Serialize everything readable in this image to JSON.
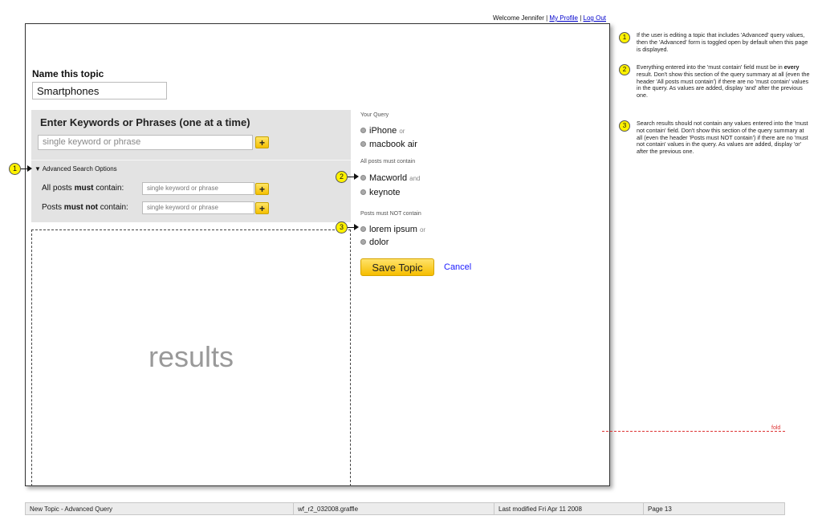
{
  "header": {
    "welcome_text": "Welcome Jennifer",
    "separator": "|",
    "my_profile": "My Profile",
    "log_out": "Log Out"
  },
  "topic": {
    "label": "Name this topic",
    "value": "Smartphones"
  },
  "keywords": {
    "heading": "Enter Keywords or Phrases (one at a time)",
    "placeholder": "single keyword or phrase",
    "add_label": "+"
  },
  "advanced": {
    "toggle_label": "▼ Advanced Search Options",
    "must_prefix": "All posts ",
    "must_bold": "must",
    "must_suffix": " contain:",
    "mustnot_prefix": "Posts ",
    "mustnot_bold": "must not",
    "mustnot_suffix": " contain:",
    "placeholder": "single keyword or phrase",
    "add_label": "+"
  },
  "results": {
    "label": "results"
  },
  "query": {
    "your_query_heading": "Your Query",
    "your_query_items": [
      {
        "text": "iPhone",
        "conj": "or"
      },
      {
        "text": "macbook air",
        "conj": ""
      }
    ],
    "must_heading": "All posts must contain",
    "must_items": [
      {
        "text": "Macworld",
        "conj": "and"
      },
      {
        "text": "keynote",
        "conj": ""
      }
    ],
    "not_heading": "Posts must NOT contain",
    "not_items": [
      {
        "text": "lorem ipsum",
        "conj": "or"
      },
      {
        "text": "dolor",
        "conj": ""
      }
    ]
  },
  "actions": {
    "save": "Save Topic",
    "cancel": "Cancel"
  },
  "callouts": [
    "1",
    "2",
    "3"
  ],
  "notes": [
    {
      "num": "1",
      "text": "If the user is editing a topic that includes 'Advanced' query values, then the 'Advanced' form is toggled open by default when this page is displayed."
    },
    {
      "num": "2",
      "text_before": "Everything entered into the 'must contain' field must be in ",
      "bold": "every",
      "text_after": " result. Don't show this section of the query summary at all (even the header 'All posts must contain') if there are no 'must contain' values in the query. As values are added, display 'and' after the previous one."
    },
    {
      "num": "3",
      "text": "Search results should not contain any values entered into the 'must not contain' field. Don't show this section of the query summary at all (even the header 'Posts must NOT contain') if there are no 'must not contain' values in the query. As values are added, display 'or' after the previous one."
    }
  ],
  "fold_label": "fold",
  "footer": {
    "title": "New Topic - Advanced Query",
    "file": "wf_r2_032008.graffle",
    "modified": "Last modified Fri Apr 11 2008",
    "page": "Page 13"
  }
}
